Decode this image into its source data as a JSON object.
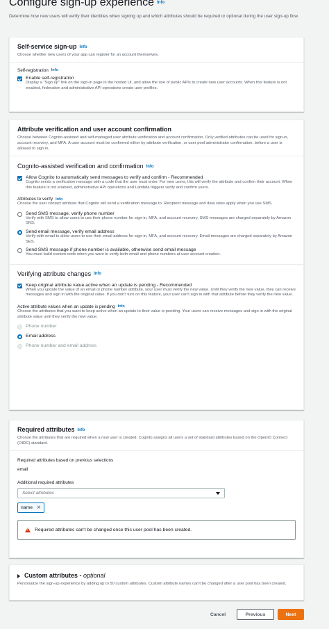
{
  "page": {
    "title": "Configure sign-up experience",
    "info": "Info",
    "description": "Determine how new users will verify their identities when signing up and which attributes should be required or optional during the user sign-up flow."
  },
  "self_service": {
    "title": "Self-service sign-up",
    "info": "Info",
    "description": "Choose whether new users of your app can register for an account themselves.",
    "field_label": "Self-registration",
    "field_info": "Info",
    "checkbox_label": "Enable self-registration",
    "checkbox_desc": "Display a \"Sign up\" link on the sign-in page in the hosted UI, and allow the use of public APIs to create new user accounts. When this feature is not enabled, federation and administrative API operations create user profiles."
  },
  "attr_verification": {
    "title": "Attribute verification and user account confirmation",
    "description": "Choose between Cognito-assisted and self-managed user attribute verification and account confirmation. Only verified attributes can be used for sign-in, account recovery, and MFA. A user account must be confirmed either by attribute verification, or user pool administrator confirmation, before a user is allowed to sign in.",
    "cognito_title": "Cognito-assisted verification and confirmation",
    "cognito_info": "Info",
    "allow_label": "Allow Cognito to automatically send messages to verify and confirm - Recommended",
    "allow_desc": "Cognito sends a verification message with a code that the user must enter. For new users, this will verify the attribute and confirm their account. When this feature is not enabled, administrative API operations and Lambda triggers verify and confirm users.",
    "attrs_label": "Attributes to verify",
    "attrs_info": "Info",
    "attrs_desc": "Choose the user contact attribute that Cognito will send a verification message to. Recipient message and data rates apply when you use SMS.",
    "options": [
      {
        "label": "Send SMS message, verify phone number",
        "desc": "Verify with SMS to allow users to use their phone number for sign-in, MFA, and account recovery. SMS messages are charged separately by Amazon SNS."
      },
      {
        "label": "Send email message, verify email address",
        "desc": "Verify with email to allow users to use their email address for sign-in, MFA, and account recovery. Email messages are charged separately by Amazon SES."
      },
      {
        "label": "Send SMS message if phone number is available, otherwise send email message",
        "desc": "You must build custom code when you want to verify both email and phone numbers at user account creation."
      }
    ],
    "selected_option": 1,
    "changes_title": "Verifying attribute changes",
    "changes_info": "Info",
    "keep_label": "Keep original attribute value active when an update is pending - Recommended",
    "keep_desc": "When you update the value of an email or phone number attribute, your user must verify the new value. Until they verify the new value, they can receive messages and sign in with the original value. If you don't turn on this feature, your user can't sign in with that attribute before they verify the new value.",
    "active_label": "Active attribute values when an update is pending",
    "active_info": "Info",
    "active_desc": "Choose the attributes that you want to keep active when an update to their value is pending. Your users can receive messages and sign in with the original attribute value until they verify the new value.",
    "active_options": [
      "Phone number",
      "Email address",
      "Phone number and email address"
    ],
    "active_selected": 1
  },
  "required_attrs": {
    "title": "Required attributes",
    "info": "Info",
    "description": "Choose the attributes that are required when a new user is created. Cognito assigns all users a set of standard attributes based on the OpenID Connect (OIDC) standard.",
    "prev_label": "Required attributes based on previous selections",
    "prev_value": "email",
    "additional_label": "Additional required attributes",
    "select_placeholder": "Select attributes",
    "token": "name",
    "alert": "Required attributes can't be changed once this user pool has been created."
  },
  "custom_attrs": {
    "title": "Custom attributes -",
    "title_optional": "optional",
    "description": "Personalize the sign-up experience by adding up to 50 custom attributes. Custom attribute names can't be changed after a user pool has been created."
  },
  "footer": {
    "cancel": "Cancel",
    "previous": "Previous",
    "next": "Next"
  },
  "colors": {
    "accent": "#0073bb",
    "primary_button": "#ec7211",
    "error": "#d13212"
  }
}
